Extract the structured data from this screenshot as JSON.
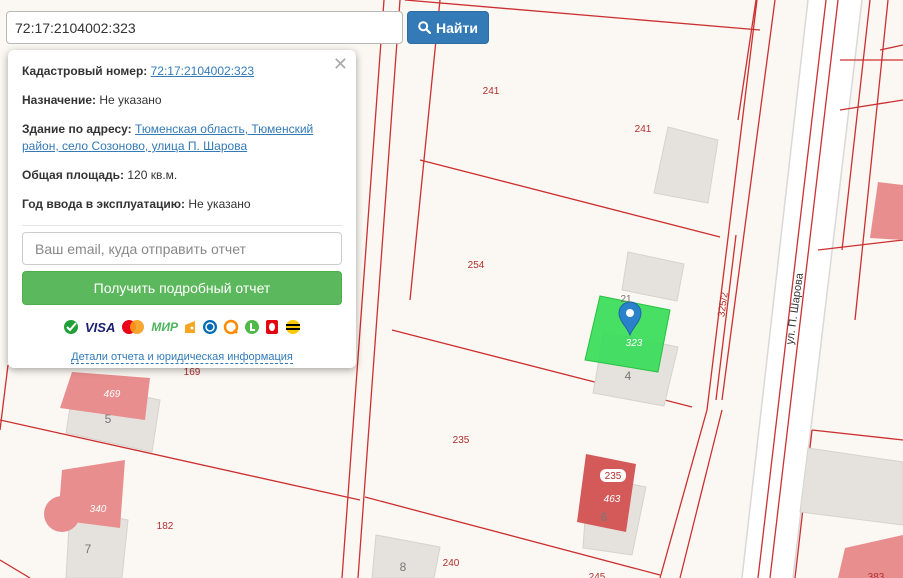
{
  "search": {
    "value": "72:17:2104002:323",
    "button_label": "Найти"
  },
  "popup": {
    "cadastral_label": "Кадастровый номер:",
    "cadastral_value": "72:17:2104002:323",
    "purpose_label": "Назначение:",
    "purpose_value": "Не указано",
    "address_label": "Здание по адресу:",
    "address_value": "Тюменская область, Тюменский район, село Созоново, улица П. Шарова",
    "area_label": "Общая площадь:",
    "area_value": "120 кв.м.",
    "year_label": "Год ввода в эксплуатацию:",
    "year_value": "Не указано",
    "email_placeholder": "Ваш email, куда отправить отчет",
    "report_button": "Получить подробный отчет",
    "details_link": "Детали отчета и юридическая информация",
    "payment_methods": [
      "sberbank-icon",
      "visa-icon",
      "mastercard-icon",
      "mir-icon",
      "yandex-money-icon",
      "webmoney-icon",
      "qiwi-icon",
      "euroset-icon",
      "mts-icon",
      "beeline-icon"
    ],
    "payment_text": {
      "visa": "VISA",
      "mir": "МИР"
    }
  },
  "map": {
    "colors": {
      "background": "#fbf7f2",
      "boundary": "#cc3030",
      "building": "#e5e1dd",
      "building_red": "#e88e8e",
      "building_dark_red": "#d45a5a",
      "selected": "#33dd55",
      "marker": "#2a82cb"
    },
    "parcel_labels": {
      "p241a": "241",
      "p241b": "241",
      "p254": "254",
      "p235": "235",
      "p240": "240",
      "p182": "182",
      "p169": "169",
      "p325": "325/2",
      "p383": "383",
      "p245": "245"
    },
    "building_labels": {
      "b469": "469",
      "b340": "340",
      "b463": "463",
      "b235": "235",
      "b323": "323",
      "b21": "21",
      "n4": "4",
      "n5": "5",
      "n6": "6",
      "n7": "7",
      "n8": "8"
    },
    "street_label": "ул. П. Шарова"
  }
}
